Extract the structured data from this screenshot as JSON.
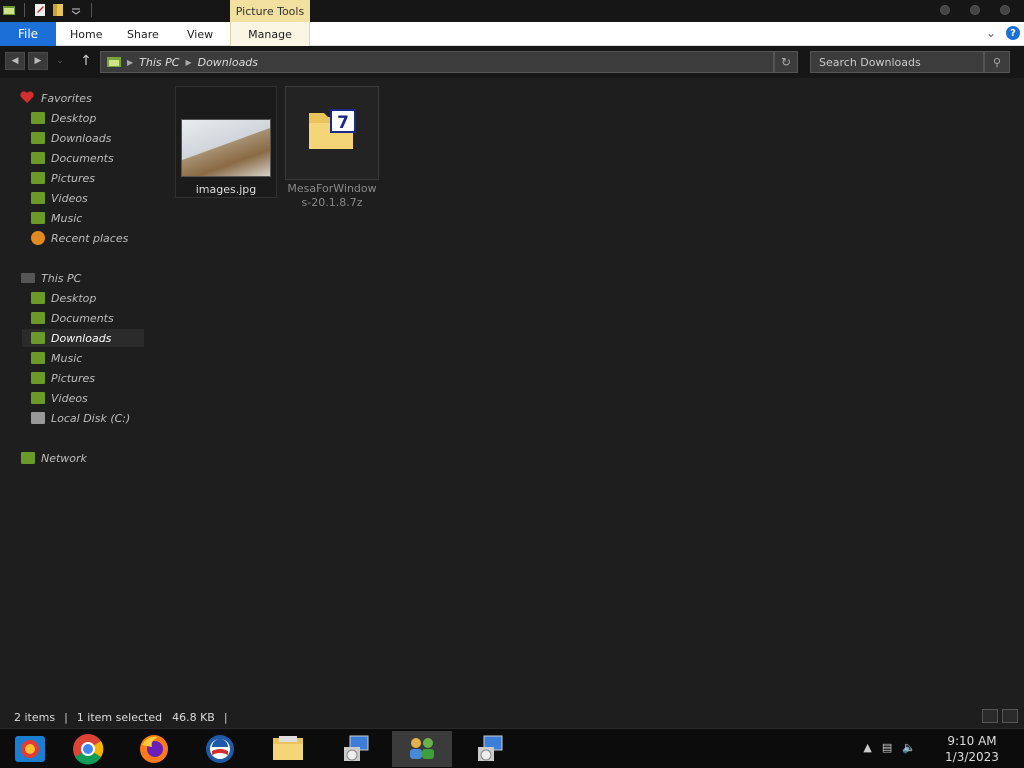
{
  "titlebar": {
    "context_tab": "Picture Tools",
    "icons": [
      "explorer-icon",
      "properties-icon",
      "new-folder-icon",
      "qat-dropdown-icon"
    ]
  },
  "ribbon": {
    "file": "File",
    "tabs": [
      "Home",
      "Share",
      "View"
    ],
    "manage": "Manage",
    "help": "?"
  },
  "navbar": {
    "path": [
      "This PC",
      "Downloads"
    ],
    "search_placeholder": "Search Downloads"
  },
  "sidebar": {
    "favorites_header": "Favorites",
    "favorites": [
      "Desktop",
      "Downloads",
      "Documents",
      "Pictures",
      "Videos",
      "Music",
      "Recent places"
    ],
    "thispc_header": "This PC",
    "thispc": [
      "Desktop",
      "Documents",
      "Downloads",
      "Music",
      "Pictures",
      "Videos",
      "Local Disk (C:)"
    ],
    "network": "Network",
    "selected": "Downloads"
  },
  "files": [
    {
      "name": "images.jpg",
      "type": "image",
      "selected": true
    },
    {
      "name_line1": "MesaForWindow",
      "name_line2": "s-20.1.8.7z",
      "type": "7z-archive",
      "selected": false
    }
  ],
  "status": {
    "count": "2 items",
    "selection": "1 item selected",
    "size": "46.8 KB"
  },
  "taskbar": {
    "apps": [
      "windows-store-icon",
      "chrome-icon",
      "firefox-icon",
      "obama-app-icon",
      "file-explorer-icon",
      "installer-icon",
      "network-people-icon",
      "installer-icon-2"
    ],
    "active_index": 6,
    "time": "9:10 AM",
    "date": "1/3/2023"
  },
  "colors": {
    "file_tab": "#1c6fd6",
    "context_tab": "#f2e0a0",
    "background": "#1e1e1e"
  }
}
